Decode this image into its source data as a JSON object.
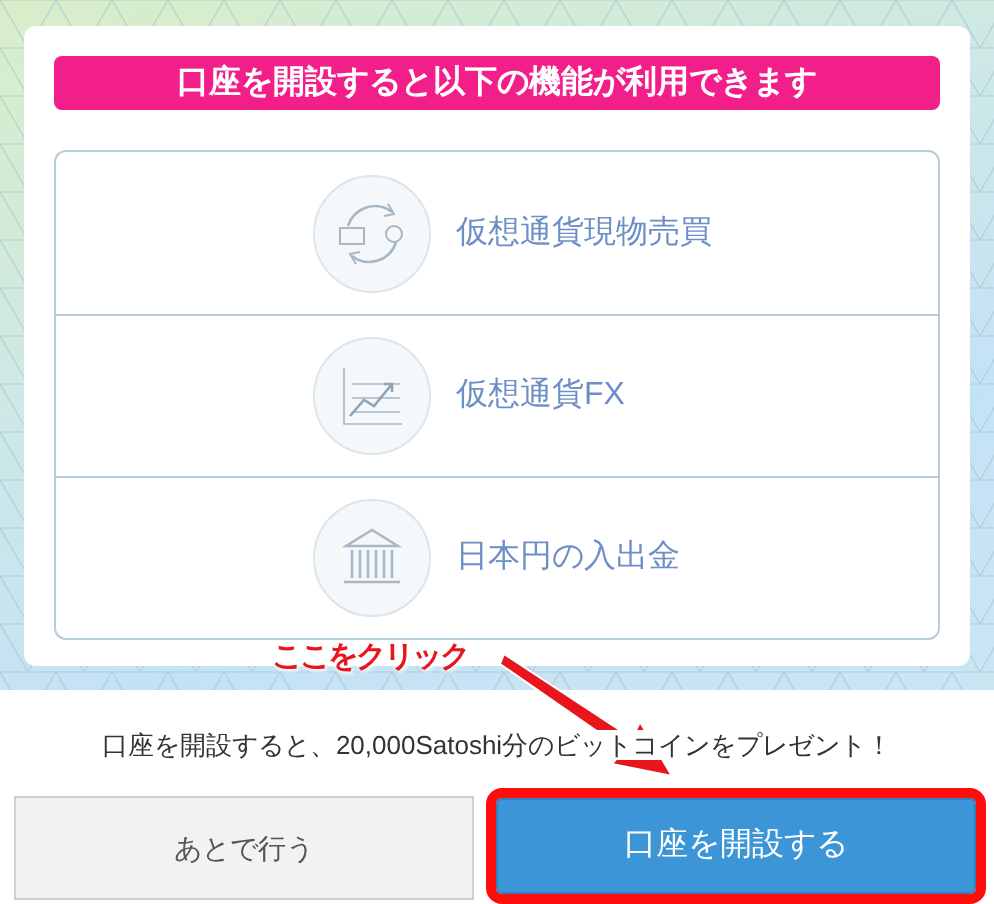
{
  "header": "口座を開設すると以下の機能が利用できます",
  "features": [
    {
      "kind": "exchange",
      "label": "仮想通貨現物売買"
    },
    {
      "kind": "chart",
      "label": "仮想通貨FX"
    },
    {
      "kind": "bank",
      "label": "日本円の入出金"
    }
  ],
  "annotation": {
    "label": "ここをクリック"
  },
  "promo": "口座を開設すると、20,000Satoshi分のビットコインをプレゼント！",
  "buttons": [
    {
      "kind": "secondary",
      "label": "あとで行う",
      "highlighted": false
    },
    {
      "kind": "primary",
      "label": "口座を開設する",
      "highlighted": true
    }
  ]
}
